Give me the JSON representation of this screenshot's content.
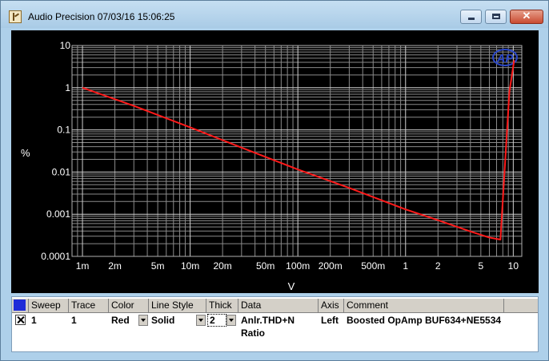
{
  "window": {
    "title": "Audio Precision  07/03/16 15:06:25",
    "close_label": "✕"
  },
  "chart_data": {
    "type": "line",
    "title": "",
    "xlabel": "V",
    "ylabel": "%",
    "xscale": "log",
    "yscale": "log",
    "xlim": [
      0.0008,
      12
    ],
    "ylim": [
      0.0001,
      10
    ],
    "x_ticks": [
      "1m",
      "2m",
      "5m",
      "10m",
      "20m",
      "50m",
      "100m",
      "200m",
      "500m",
      "1",
      "2",
      "5",
      "10"
    ],
    "y_ticks": [
      "10",
      "1",
      "0.1",
      "0.01",
      "0.001",
      "0.0001"
    ],
    "grid": true,
    "logo": "AP",
    "series": [
      {
        "color": "#ff1a1a",
        "x": [
          0.001,
          0.003,
          0.01,
          0.03,
          0.1,
          0.3,
          1,
          2,
          4,
          6,
          7.6,
          9.2,
          10.2
        ],
        "y": [
          1.0,
          0.37,
          0.115,
          0.038,
          0.0115,
          0.0042,
          0.0013,
          0.00072,
          0.00039,
          0.00028,
          0.00025,
          0.8,
          4.5
        ]
      }
    ]
  },
  "sweep_table": {
    "headers": {
      "sweep": "Sweep",
      "trace": "Trace",
      "color": "Color",
      "line_style": "Line Style",
      "thick": "Thick",
      "data": "Data",
      "axis": "Axis",
      "comment": "Comment"
    },
    "row": {
      "sweep": "1",
      "trace": "1",
      "color": "Red",
      "line_style": "Solid",
      "thick": "2",
      "data": "Anlr.THD+N Ratio",
      "axis": "Left",
      "comment": "Boosted OpAmp BUF634+NE5534"
    },
    "header_color": "#1e2bd8"
  }
}
